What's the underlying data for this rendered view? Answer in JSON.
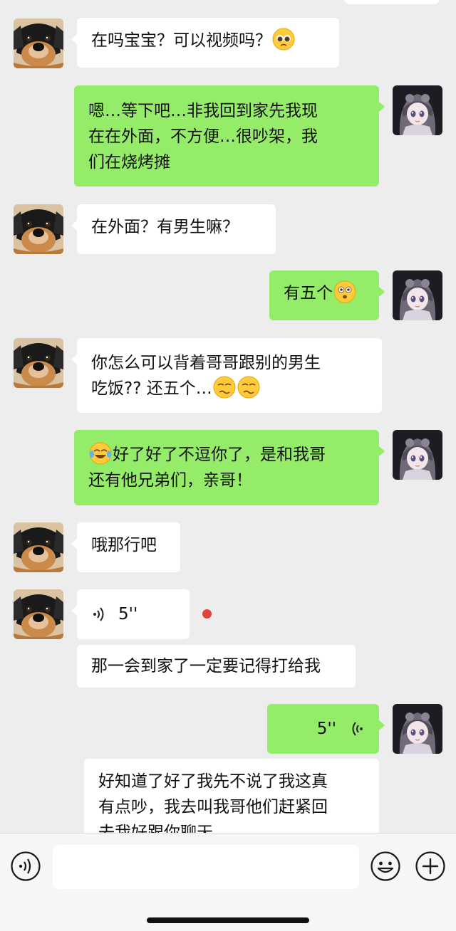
{
  "messages": [
    {
      "side": "in",
      "type": "text",
      "text": "在吗宝宝？可以视频吗？",
      "trailing_emoji": "pleading-face-emoji"
    },
    {
      "side": "out",
      "type": "text",
      "lines": [
        "嗯…等下吧…非我回到家先我现",
        "在在外面，不方便…很吵架，我",
        "们在烧烤摊"
      ]
    },
    {
      "side": "in",
      "type": "text",
      "text": "在外面？有男生嘛？"
    },
    {
      "side": "out",
      "type": "text",
      "text": "有五个",
      "trailing_emoji": "flushed-face-emoji"
    },
    {
      "side": "in",
      "type": "text",
      "lines": [
        "你怎么可以背着哥哥跟别的男生",
        "吃饭??  还五个…"
      ],
      "trailing_emojis": [
        "woozy-face-emoji",
        "woozy-face-emoji"
      ]
    },
    {
      "side": "out",
      "type": "text",
      "leading_emoji": "tears-of-joy-emoji",
      "lines": [
        "好了好了不逗你了，是和我哥",
        "还有他兄弟们，亲哥！"
      ]
    },
    {
      "side": "in",
      "type": "text",
      "text": "哦那行吧"
    },
    {
      "side": "in",
      "type": "voice",
      "duration": "5''",
      "unread": true
    },
    {
      "side": "in",
      "type": "text",
      "text": "那一会到家了一定要记得打给我"
    },
    {
      "side": "out",
      "type": "voice",
      "duration": "5''"
    },
    {
      "side": "in",
      "type": "text",
      "lines": [
        "好知道了好了我先不说了我这真",
        "有点吵，我去叫我哥他们赶紧回",
        "去我好跟你聊天"
      ]
    }
  ],
  "icons": {
    "voice_toggle": "voice-mode-icon",
    "emoji_button": "emoji-icon",
    "more_button": "plus-icon"
  },
  "colors": {
    "background": "#ededed",
    "incoming_bubble": "#ffffff",
    "outgoing_bubble": "#95ec69",
    "unread_dot": "#e0433b"
  }
}
